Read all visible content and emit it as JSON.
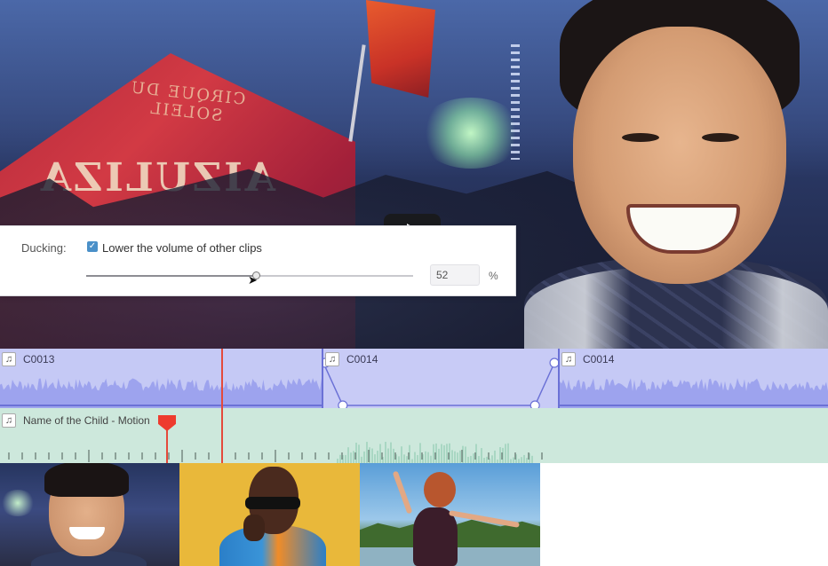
{
  "preview": {
    "tent_text": "AIZULIZA",
    "tent_small_text": "CIRQUE DU SOLEIL",
    "play_icon": "play-icon"
  },
  "ducking": {
    "label": "Ducking:",
    "checkbox_checked": true,
    "checkbox_label": "Lower the volume of other clips",
    "value": "52",
    "value_fraction": 0.52,
    "unit": "%"
  },
  "timeline": {
    "audio_clips": [
      {
        "name": "C0013"
      },
      {
        "name": "C0014"
      },
      {
        "name": "C0014"
      }
    ],
    "music_track": {
      "name": "Name of the Child - Motion"
    },
    "colors": {
      "audio_clip": "#c5c9f5",
      "audio_accent": "#6b71d6",
      "music_track": "#cde8dc",
      "playhead": "#e44a3b"
    }
  }
}
